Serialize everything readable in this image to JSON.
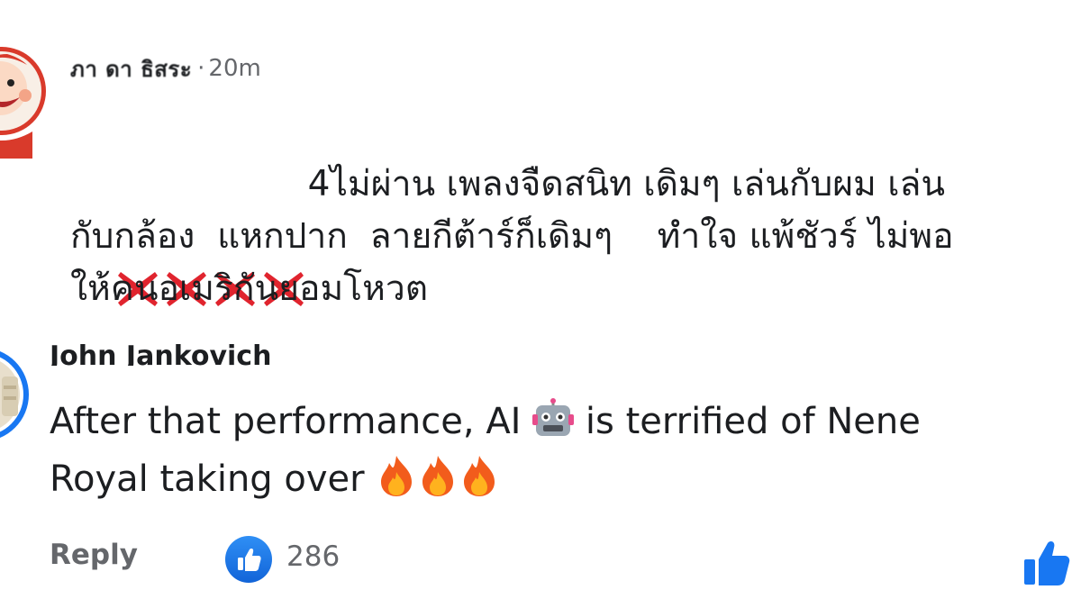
{
  "comments": [
    {
      "author": "ภา ดา ธิสระ",
      "separator": "·",
      "time": "20m",
      "prefix_icons": [
        "x-mark-icon",
        "x-mark-icon",
        "x-mark-icon",
        "x-mark-icon"
      ],
      "text": "4ไม่ผ่าน เพลงจืดสนิท เดิมๆ เล่นกับผม เล่น\nกับกล้อง  แหกปาก  ลายกีต้าร์ก็เดิมๆ    ทำใจ แพ้ชัวร์ ไม่พอ\nให้คนอเมริกันยอมโหวต"
    },
    {
      "author": "John Jankovich",
      "text_part1": "After that performance, AI ",
      "emoji_icon": "robot-face-icon",
      "text_part2": " is terrified of Nene",
      "text_part3": "Royal taking over ",
      "trailing_icons": [
        "fire-icon",
        "fire-icon",
        "fire-icon"
      ]
    }
  ],
  "footer": {
    "reply_label": "Reply",
    "like_count": "286",
    "reaction_icon": "thumbs-up-icon"
  },
  "colors": {
    "text": "#1c1e21",
    "muted": "#65676b",
    "like_blue": "#1877f2",
    "x_red": "#e0242e"
  }
}
